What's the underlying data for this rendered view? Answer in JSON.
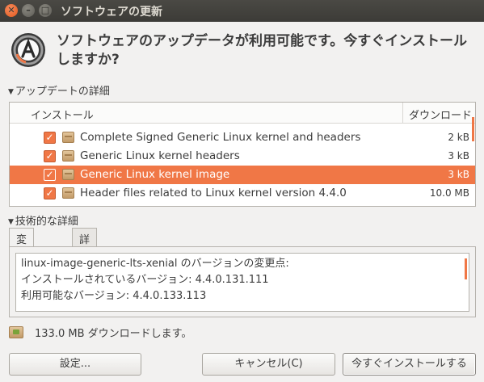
{
  "window": {
    "title": "ソフトウェアの更新",
    "close_glyph": "✕",
    "min_glyph": "–",
    "max_glyph": "□"
  },
  "headline": "ソフトウェアのアップデータが利用可能です。今すぐインストールしますか?",
  "details_section": {
    "label": "アップデートの詳細",
    "columns": {
      "install": "インストール",
      "download": "ダウンロード"
    },
    "items": [
      {
        "name": "Complete Signed Generic Linux kernel and headers",
        "size": "2 kB",
        "checked": true,
        "selected": false
      },
      {
        "name": "Generic Linux kernel headers",
        "size": "3 kB",
        "checked": true,
        "selected": false
      },
      {
        "name": "Generic Linux kernel image",
        "size": "3 kB",
        "checked": true,
        "selected": true
      },
      {
        "name": "Header files related to Linux kernel version 4.4.0",
        "size": "10.0 MB",
        "checked": true,
        "selected": false
      }
    ]
  },
  "technical_section": {
    "label": "技術的な詳細",
    "tabs": [
      {
        "label": "変更箇所",
        "active": true
      },
      {
        "label": "詳細",
        "active": false
      }
    ],
    "changes": [
      "linux-image-generic-lts-xenial のバージョンの変更点:",
      "インストールされているバージョン: 4.4.0.131.111",
      "利用可能なバージョン: 4.4.0.133.113"
    ]
  },
  "download_summary": "133.0 MB ダウンロードします。",
  "buttons": {
    "settings": "設定...",
    "cancel": "キャンセル(C)",
    "install": "今すぐインストールする"
  },
  "colors": {
    "accent": "#f07746",
    "titlebar": "#3c3b37",
    "window_bg": "#f2f1f0"
  },
  "icons": {
    "app": "software-updater-icon",
    "package": "package-icon",
    "download": "download-package-icon"
  }
}
